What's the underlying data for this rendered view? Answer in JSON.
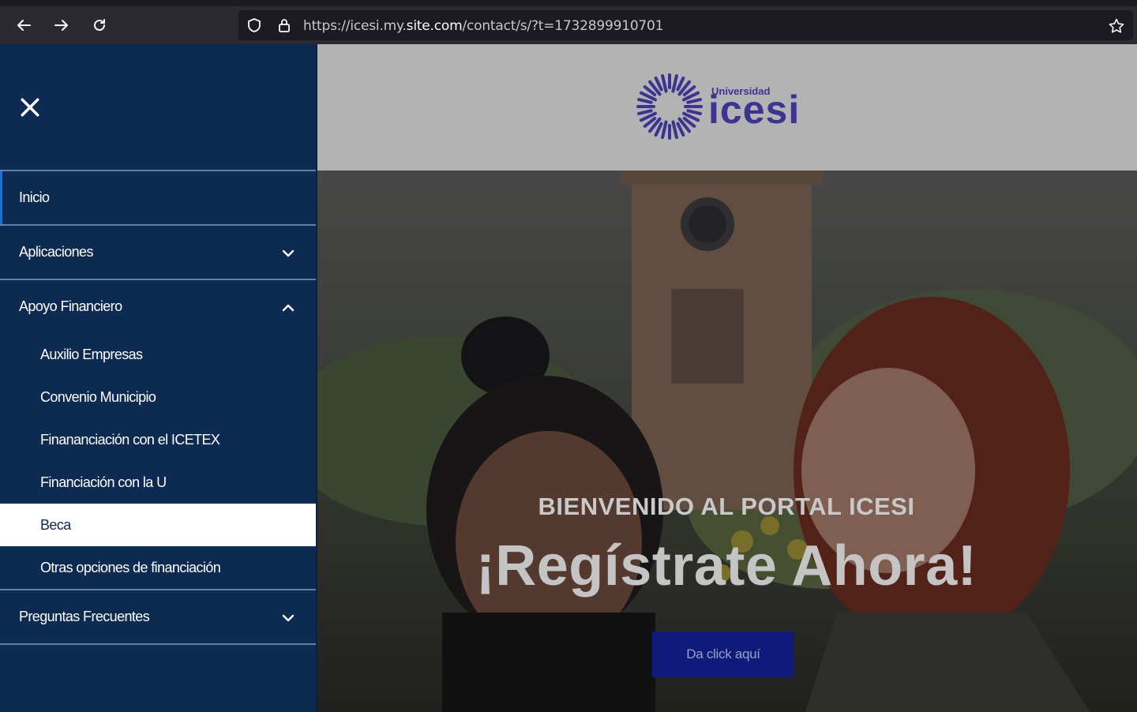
{
  "browser": {
    "url_prefix": "https://icesi.my.",
    "url_domain": "site.com",
    "url_suffix": "/contact/s/?t=1732899910701"
  },
  "logo": {
    "small_text": "Universidad",
    "big_text": "icesi"
  },
  "sidebar": {
    "items": [
      {
        "label": "Inicio"
      },
      {
        "label": "Aplicaciones"
      },
      {
        "label": "Apoyo Financiero"
      },
      {
        "label": "Preguntas Frecuentes"
      }
    ],
    "submenu": [
      {
        "label": "Auxilio Empresas"
      },
      {
        "label": "Convenio Municipio"
      },
      {
        "label": "Finananciación con el ICETEX"
      },
      {
        "label": "Financiación con la U"
      },
      {
        "label": "Beca"
      },
      {
        "label": "Otras opciones de financiación"
      }
    ]
  },
  "hero": {
    "subtitle": "BIENVENIDO AL PORTAL ICESI",
    "title": "¡Regístrate Ahora!",
    "cta_label": "Da click aquí"
  },
  "colors": {
    "sidebar_bg": "#0d2a52",
    "cta_bg": "#0f1a7a",
    "brand": "#3d3491"
  }
}
